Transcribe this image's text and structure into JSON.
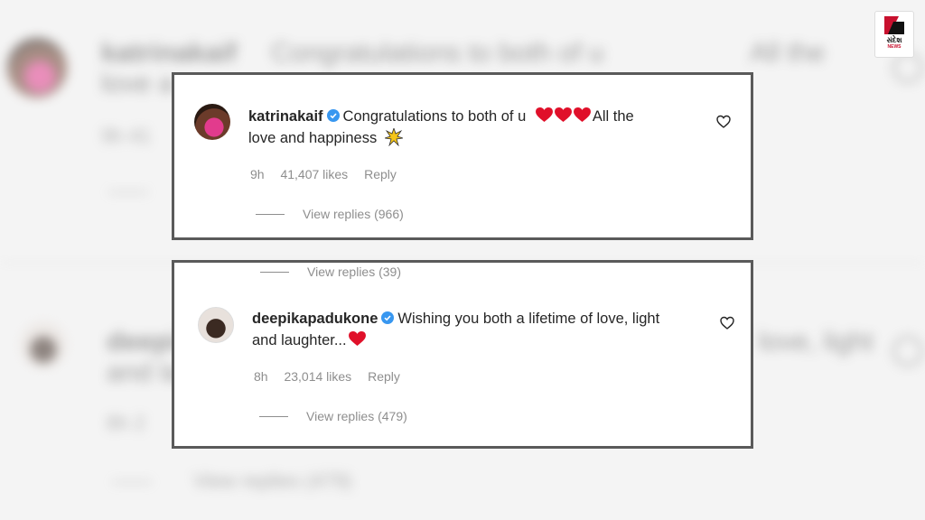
{
  "brand": {
    "name": "સંદેશ",
    "sub": "NEWS",
    "color": "#c8102e"
  },
  "colors": {
    "heart": "#e0102a",
    "verified": "#3897f0",
    "border": "#5a5a5a"
  },
  "comments": [
    {
      "username": "katrinakaif",
      "verified": true,
      "text_before": "Congratulations to both of u",
      "hearts": 3,
      "text_after": "All the",
      "text_line2": "love and happiness",
      "emoji": "sparkle",
      "time": "9h",
      "likes": "41,407 likes",
      "reply": "Reply",
      "view_replies": "View replies (966)"
    },
    {
      "username": "deepikapadukone",
      "verified": true,
      "text_before": "Wishing you both a lifetime of love, light",
      "text_line2": "and laughter...",
      "hearts": 1,
      "time": "8h",
      "likes": "23,014 likes",
      "reply": "Reply",
      "view_replies": "View replies (479)",
      "prev_view_replies": "View replies (39)"
    }
  ],
  "background": {
    "line1": "katrinakaif",
    "line1b": "Congratulations to both of u",
    "line1c": "All the",
    "line2": "love a",
    "meta": "9h   41",
    "user2": "deepi",
    "line3": "and la",
    "line3r": "love, light",
    "meta2": "8h   2",
    "view": "View replies (479)"
  }
}
